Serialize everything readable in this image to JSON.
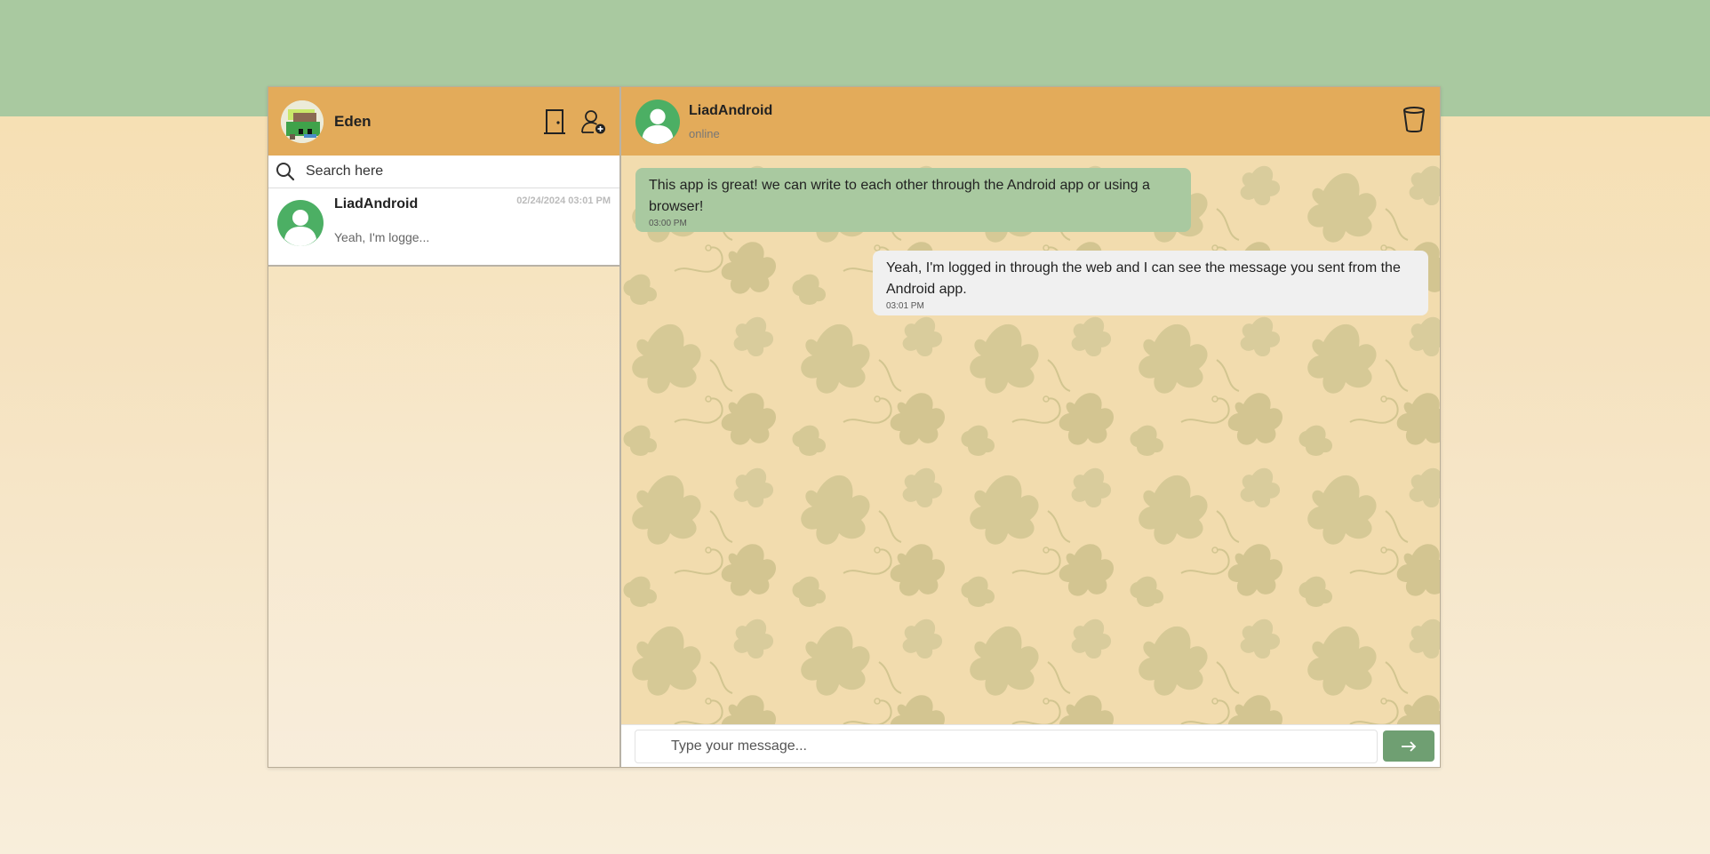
{
  "colors": {
    "accent_header": "#e3ab5a",
    "top_band": "#a9c9a0",
    "incoming_bubble": "#a9c9a0",
    "outgoing_bubble": "#f0f0f0",
    "send_button": "#6f9f72",
    "avatar_green": "#4caf64"
  },
  "user": {
    "name": "Eden"
  },
  "header_icons": {
    "logout": "door-icon",
    "add_contact": "add-user-icon"
  },
  "search": {
    "placeholder": "Search here",
    "icon": "search-icon"
  },
  "contacts": [
    {
      "name": "LiadAndroid",
      "last_message": "Yeah, I'm logge...",
      "time": "02/24/2024 03:01 PM"
    }
  ],
  "chat": {
    "name": "LiadAndroid",
    "status": "online",
    "delete_icon": "trash-icon",
    "messages": [
      {
        "direction": "incoming",
        "text": "This app is great! we can write to each other through the Android app or using a browser!",
        "time": "03:00 PM"
      },
      {
        "direction": "outgoing",
        "text": "Yeah, I'm logged in through the web and I can see the message you sent from the Android app.",
        "time": "03:01 PM"
      }
    ]
  },
  "composer": {
    "placeholder": "Type your message...",
    "send_icon": "arrow-right-icon"
  }
}
